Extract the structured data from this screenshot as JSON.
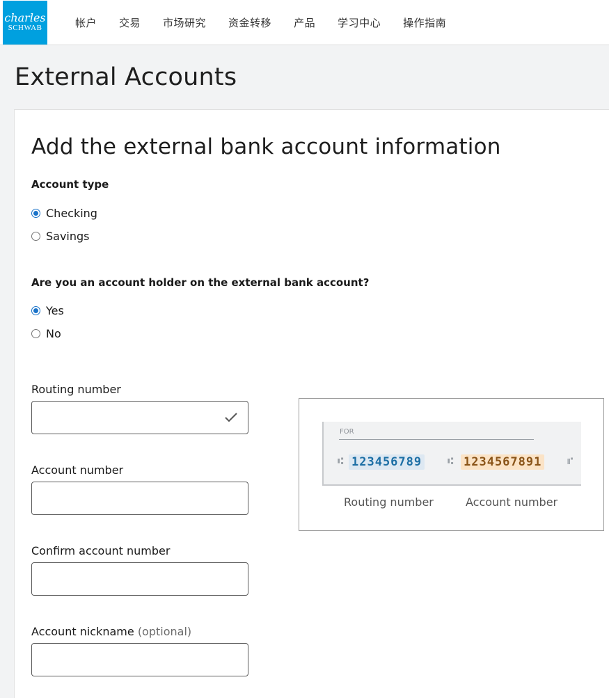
{
  "brand": {
    "line1": "charles",
    "line2": "SCHWAB",
    "color": "#00a0df"
  },
  "nav": [
    {
      "label": "帐户"
    },
    {
      "label": "交易"
    },
    {
      "label": "市场研究"
    },
    {
      "label": "资金转移"
    },
    {
      "label": "产品"
    },
    {
      "label": "学习中心"
    },
    {
      "label": "操作指南"
    }
  ],
  "page": {
    "title": "External Accounts"
  },
  "form": {
    "heading": "Add the external bank account information",
    "account_type": {
      "label": "Account type",
      "options": [
        {
          "label": "Checking",
          "checked": true
        },
        {
          "label": "Savings",
          "checked": false
        }
      ]
    },
    "holder": {
      "label": "Are you an account holder on the external bank account?",
      "options": [
        {
          "label": "Yes",
          "checked": true
        },
        {
          "label": "No",
          "checked": false
        }
      ]
    },
    "routing": {
      "label": "Routing number",
      "value": "",
      "valid_icon": "check-icon"
    },
    "account_number": {
      "label": "Account number",
      "value": ""
    },
    "confirm_account": {
      "label": "Confirm account number",
      "value": ""
    },
    "nickname": {
      "label": "Account nickname",
      "optional": "(optional)",
      "value": ""
    }
  },
  "check_image": {
    "for_label": "FOR",
    "routing_digits": "123456789",
    "account_digits": "1234567891",
    "routing_caption": "Routing number",
    "account_caption": "Account number",
    "routing_color": "#1d6fa5",
    "account_color": "#8a5418"
  },
  "colors": {
    "radio_checked": "#1a73c9"
  }
}
